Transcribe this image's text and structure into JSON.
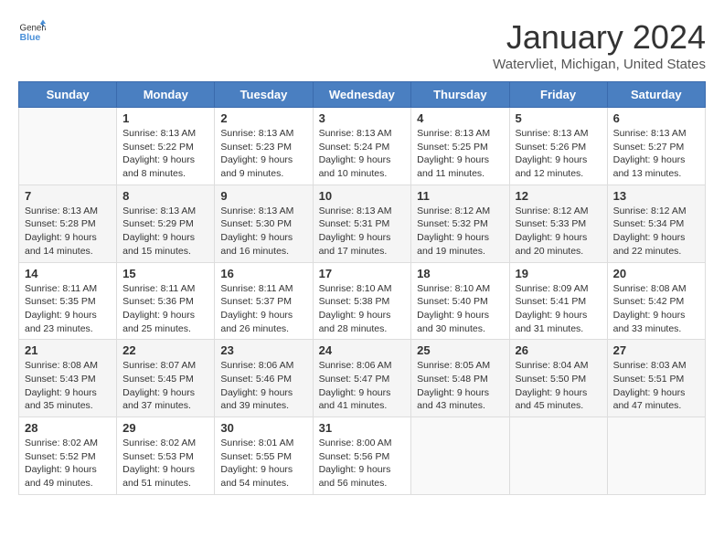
{
  "header": {
    "logo": {
      "general": "General",
      "blue": "Blue"
    },
    "title": "January 2024",
    "location": "Watervliet, Michigan, United States"
  },
  "weekdays": [
    "Sunday",
    "Monday",
    "Tuesday",
    "Wednesday",
    "Thursday",
    "Friday",
    "Saturday"
  ],
  "weeks": [
    [
      {
        "day": null
      },
      {
        "day": 1,
        "sunrise": "Sunrise: 8:13 AM",
        "sunset": "Sunset: 5:22 PM",
        "daylight": "Daylight: 9 hours and 8 minutes."
      },
      {
        "day": 2,
        "sunrise": "Sunrise: 8:13 AM",
        "sunset": "Sunset: 5:23 PM",
        "daylight": "Daylight: 9 hours and 9 minutes."
      },
      {
        "day": 3,
        "sunrise": "Sunrise: 8:13 AM",
        "sunset": "Sunset: 5:24 PM",
        "daylight": "Daylight: 9 hours and 10 minutes."
      },
      {
        "day": 4,
        "sunrise": "Sunrise: 8:13 AM",
        "sunset": "Sunset: 5:25 PM",
        "daylight": "Daylight: 9 hours and 11 minutes."
      },
      {
        "day": 5,
        "sunrise": "Sunrise: 8:13 AM",
        "sunset": "Sunset: 5:26 PM",
        "daylight": "Daylight: 9 hours and 12 minutes."
      },
      {
        "day": 6,
        "sunrise": "Sunrise: 8:13 AM",
        "sunset": "Sunset: 5:27 PM",
        "daylight": "Daylight: 9 hours and 13 minutes."
      }
    ],
    [
      {
        "day": 7,
        "sunrise": "Sunrise: 8:13 AM",
        "sunset": "Sunset: 5:28 PM",
        "daylight": "Daylight: 9 hours and 14 minutes."
      },
      {
        "day": 8,
        "sunrise": "Sunrise: 8:13 AM",
        "sunset": "Sunset: 5:29 PM",
        "daylight": "Daylight: 9 hours and 15 minutes."
      },
      {
        "day": 9,
        "sunrise": "Sunrise: 8:13 AM",
        "sunset": "Sunset: 5:30 PM",
        "daylight": "Daylight: 9 hours and 16 minutes."
      },
      {
        "day": 10,
        "sunrise": "Sunrise: 8:13 AM",
        "sunset": "Sunset: 5:31 PM",
        "daylight": "Daylight: 9 hours and 17 minutes."
      },
      {
        "day": 11,
        "sunrise": "Sunrise: 8:12 AM",
        "sunset": "Sunset: 5:32 PM",
        "daylight": "Daylight: 9 hours and 19 minutes."
      },
      {
        "day": 12,
        "sunrise": "Sunrise: 8:12 AM",
        "sunset": "Sunset: 5:33 PM",
        "daylight": "Daylight: 9 hours and 20 minutes."
      },
      {
        "day": 13,
        "sunrise": "Sunrise: 8:12 AM",
        "sunset": "Sunset: 5:34 PM",
        "daylight": "Daylight: 9 hours and 22 minutes."
      }
    ],
    [
      {
        "day": 14,
        "sunrise": "Sunrise: 8:11 AM",
        "sunset": "Sunset: 5:35 PM",
        "daylight": "Daylight: 9 hours and 23 minutes."
      },
      {
        "day": 15,
        "sunrise": "Sunrise: 8:11 AM",
        "sunset": "Sunset: 5:36 PM",
        "daylight": "Daylight: 9 hours and 25 minutes."
      },
      {
        "day": 16,
        "sunrise": "Sunrise: 8:11 AM",
        "sunset": "Sunset: 5:37 PM",
        "daylight": "Daylight: 9 hours and 26 minutes."
      },
      {
        "day": 17,
        "sunrise": "Sunrise: 8:10 AM",
        "sunset": "Sunset: 5:38 PM",
        "daylight": "Daylight: 9 hours and 28 minutes."
      },
      {
        "day": 18,
        "sunrise": "Sunrise: 8:10 AM",
        "sunset": "Sunset: 5:40 PM",
        "daylight": "Daylight: 9 hours and 30 minutes."
      },
      {
        "day": 19,
        "sunrise": "Sunrise: 8:09 AM",
        "sunset": "Sunset: 5:41 PM",
        "daylight": "Daylight: 9 hours and 31 minutes."
      },
      {
        "day": 20,
        "sunrise": "Sunrise: 8:08 AM",
        "sunset": "Sunset: 5:42 PM",
        "daylight": "Daylight: 9 hours and 33 minutes."
      }
    ],
    [
      {
        "day": 21,
        "sunrise": "Sunrise: 8:08 AM",
        "sunset": "Sunset: 5:43 PM",
        "daylight": "Daylight: 9 hours and 35 minutes."
      },
      {
        "day": 22,
        "sunrise": "Sunrise: 8:07 AM",
        "sunset": "Sunset: 5:45 PM",
        "daylight": "Daylight: 9 hours and 37 minutes."
      },
      {
        "day": 23,
        "sunrise": "Sunrise: 8:06 AM",
        "sunset": "Sunset: 5:46 PM",
        "daylight": "Daylight: 9 hours and 39 minutes."
      },
      {
        "day": 24,
        "sunrise": "Sunrise: 8:06 AM",
        "sunset": "Sunset: 5:47 PM",
        "daylight": "Daylight: 9 hours and 41 minutes."
      },
      {
        "day": 25,
        "sunrise": "Sunrise: 8:05 AM",
        "sunset": "Sunset: 5:48 PM",
        "daylight": "Daylight: 9 hours and 43 minutes."
      },
      {
        "day": 26,
        "sunrise": "Sunrise: 8:04 AM",
        "sunset": "Sunset: 5:50 PM",
        "daylight": "Daylight: 9 hours and 45 minutes."
      },
      {
        "day": 27,
        "sunrise": "Sunrise: 8:03 AM",
        "sunset": "Sunset: 5:51 PM",
        "daylight": "Daylight: 9 hours and 47 minutes."
      }
    ],
    [
      {
        "day": 28,
        "sunrise": "Sunrise: 8:02 AM",
        "sunset": "Sunset: 5:52 PM",
        "daylight": "Daylight: 9 hours and 49 minutes."
      },
      {
        "day": 29,
        "sunrise": "Sunrise: 8:02 AM",
        "sunset": "Sunset: 5:53 PM",
        "daylight": "Daylight: 9 hours and 51 minutes."
      },
      {
        "day": 30,
        "sunrise": "Sunrise: 8:01 AM",
        "sunset": "Sunset: 5:55 PM",
        "daylight": "Daylight: 9 hours and 54 minutes."
      },
      {
        "day": 31,
        "sunrise": "Sunrise: 8:00 AM",
        "sunset": "Sunset: 5:56 PM",
        "daylight": "Daylight: 9 hours and 56 minutes."
      },
      {
        "day": null
      },
      {
        "day": null
      },
      {
        "day": null
      }
    ]
  ]
}
